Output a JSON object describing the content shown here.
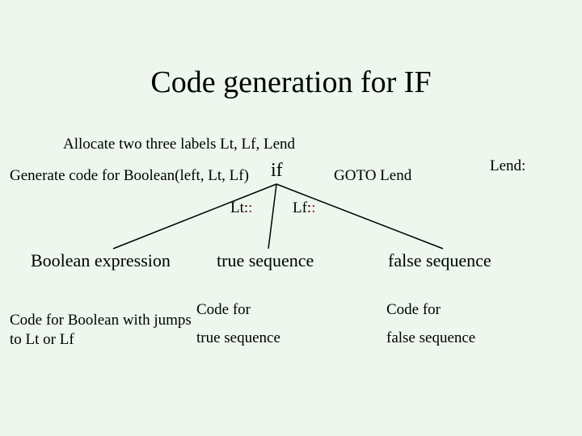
{
  "title": "Code generation for IF",
  "alloc": "Allocate two three labels Lt, Lf, Lend",
  "gen": "Generate code for Boolean(left, Lt, Lf)",
  "if_label": "if",
  "goto": "GOTO Lend",
  "lend": "Lend:",
  "lt": "Lt:",
  "lt_extra": ":",
  "lf": "Lf:",
  "lf_extra": ":",
  "bool_expr": "Boolean expression",
  "true_seq": "true sequence",
  "false_seq": "false sequence",
  "code_bool": "Code for Boolean with jumps\nto Lt or Lf",
  "code_for_t1": "Code for",
  "code_for_t2": "true sequence",
  "code_for_f1": "Code for",
  "code_for_f2": "false sequence"
}
